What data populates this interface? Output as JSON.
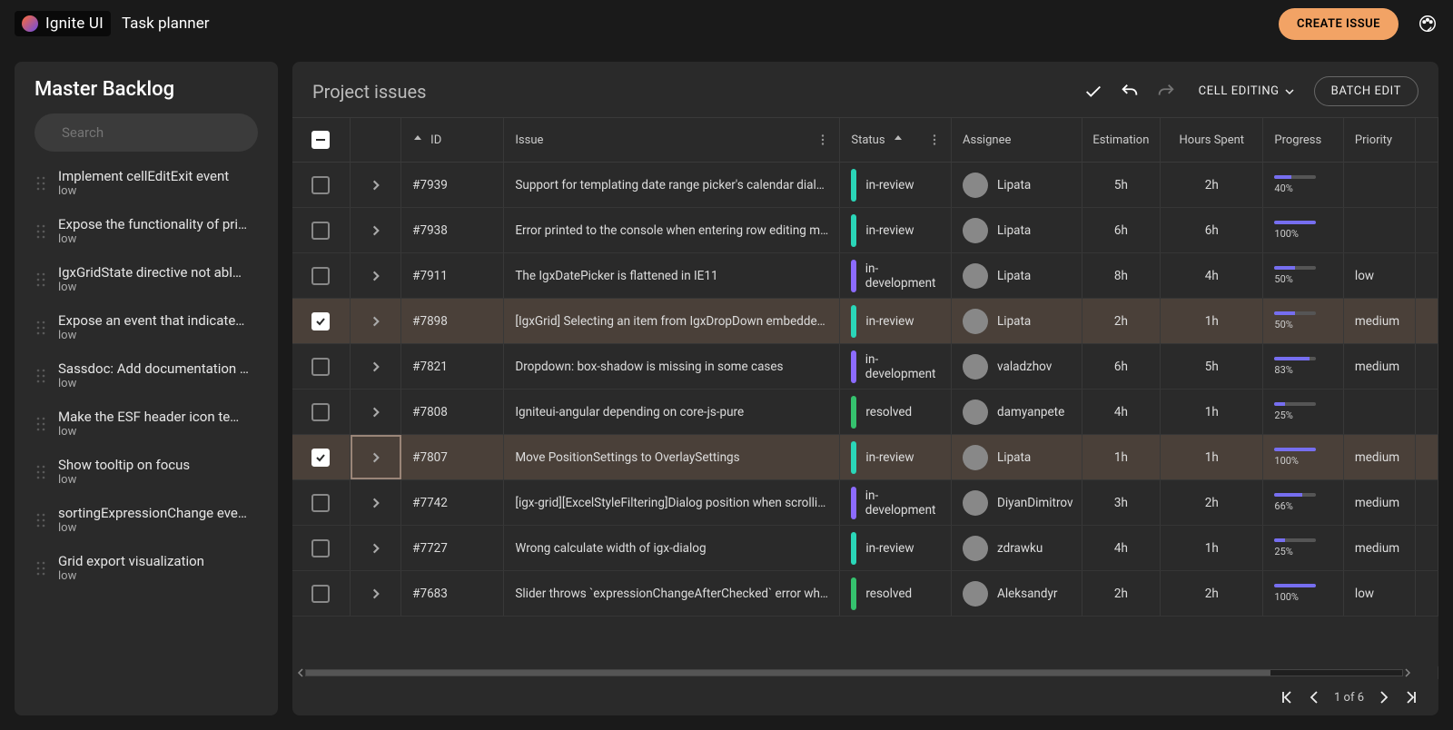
{
  "brand": "Ignite UI",
  "app_title": "Task planner",
  "create_button": "CREATE ISSUE",
  "sidebar": {
    "title": "Master Backlog",
    "search_placeholder": "Search",
    "items": [
      {
        "title": "Implement cellEditExit event",
        "sub": "low"
      },
      {
        "title": "Expose the functionality of pri…",
        "sub": "low"
      },
      {
        "title": "IgxGridState directive not abl…",
        "sub": "low"
      },
      {
        "title": "Expose an event that indicate…",
        "sub": "low"
      },
      {
        "title": "Sassdoc: Add documentation …",
        "sub": "low"
      },
      {
        "title": "Make the ESF header icon te…",
        "sub": "low"
      },
      {
        "title": "Show tooltip on focus",
        "sub": "low"
      },
      {
        "title": "sortingExpressionChange eve…",
        "sub": "low"
      },
      {
        "title": "Grid export visualization",
        "sub": "low"
      }
    ]
  },
  "main": {
    "title": "Project issues",
    "cell_editing": "CELL EDITING",
    "batch_edit": "BATCH EDIT",
    "columns": {
      "id": "ID",
      "issue": "Issue",
      "status": "Status",
      "assignee": "Assignee",
      "estimation": "Estimation",
      "hours": "Hours Spent",
      "progress": "Progress",
      "priority": "Priority"
    },
    "status_colors": {
      "in-review": "#2ad6b8",
      "in-development": "#8c6bff",
      "resolved": "#35c26e"
    },
    "rows": [
      {
        "checked": false,
        "id": "#7939",
        "issue": "Support for templating date range picker's calendar dialog c…",
        "status": "in-review",
        "assignee": "Lipata",
        "estimation": "5h",
        "hours": "2h",
        "progress": 40,
        "priority": ""
      },
      {
        "checked": false,
        "id": "#7938",
        "issue": "Error printed to the console when entering row editing mod…",
        "status": "in-review",
        "assignee": "Lipata",
        "estimation": "6h",
        "hours": "6h",
        "progress": 100,
        "priority": ""
      },
      {
        "checked": false,
        "id": "#7911",
        "issue": "The IgxDatePicker is flattened in IE11",
        "status": "in-development",
        "assignee": "Lipata",
        "estimation": "8h",
        "hours": "4h",
        "progress": 50,
        "priority": "low"
      },
      {
        "checked": true,
        "id": "#7898",
        "issue": "[IgxGrid] Selecting an item from IgxDropDown embedded in…",
        "status": "in-review",
        "assignee": "Lipata",
        "estimation": "2h",
        "hours": "1h",
        "progress": 50,
        "priority": "medium"
      },
      {
        "checked": false,
        "id": "#7821",
        "issue": "Dropdown: box-shadow is missing in some cases",
        "status": "in-development",
        "assignee": "valadzhov",
        "estimation": "6h",
        "hours": "5h",
        "progress": 83,
        "priority": "medium"
      },
      {
        "checked": false,
        "id": "#7808",
        "issue": "Igniteui-angular depending on core-js-pure",
        "status": "resolved",
        "assignee": "damyanpete",
        "estimation": "4h",
        "hours": "1h",
        "progress": 25,
        "priority": ""
      },
      {
        "checked": true,
        "id": "#7807",
        "issue": "Move PositionSettings to OverlaySettings",
        "status": "in-review",
        "assignee": "Lipata",
        "estimation": "1h",
        "hours": "1h",
        "progress": 100,
        "priority": "medium",
        "active": true
      },
      {
        "checked": false,
        "id": "#7742",
        "issue": "[igx-grid][ExcelStyleFiltering]Dialog position when scrolling…",
        "status": "in-development",
        "assignee": "DiyanDimitrov",
        "estimation": "3h",
        "hours": "2h",
        "progress": 66,
        "priority": "medium"
      },
      {
        "checked": false,
        "id": "#7727",
        "issue": "Wrong calculate width of igx-dialog",
        "status": "in-review",
        "assignee": "zdrawku",
        "estimation": "4h",
        "hours": "1h",
        "progress": 25,
        "priority": "medium"
      },
      {
        "checked": false,
        "id": "#7683",
        "issue": "Slider throws `expressionChangeAfterChecked` error when …",
        "status": "resolved",
        "assignee": "Aleksandyr",
        "estimation": "2h",
        "hours": "2h",
        "progress": 100,
        "priority": "low"
      }
    ],
    "pager": {
      "label": "1 of 6"
    }
  }
}
